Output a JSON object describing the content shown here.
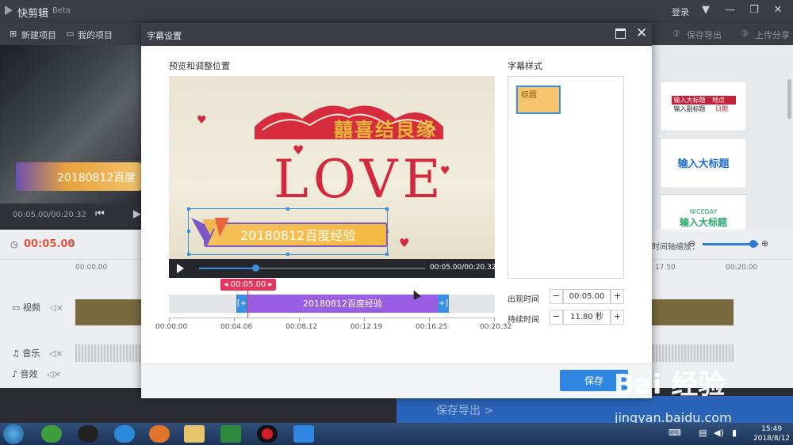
{
  "app": {
    "name": "快剪辑",
    "badge": "Beta",
    "login": "登录"
  },
  "toolbar": {
    "new_project": "新建项目",
    "my_projects": "我的项目",
    "step2": "保存导出",
    "step3": "上传分享"
  },
  "left_preview": {
    "banner_text": "20180812百度",
    "timecode": "00:05.00/00:20.32"
  },
  "timeline": {
    "current_time": "00:05.00",
    "ruler": [
      "00:00.00",
      "17.50",
      "00:20.00"
    ],
    "zoom_label": "时间轴缩放：",
    "tracks": {
      "video": "视频",
      "music": "音乐",
      "sfx": "音效"
    }
  },
  "templates": {
    "t1_title": "输入大标题",
    "t1_sub": "输入副标题",
    "t1_place": "地点",
    "t1_date": "日期",
    "t2_title": "输入大标题",
    "t3_brand": "NICEDAY",
    "t3_title": "输入大标题"
  },
  "dialog": {
    "title": "字幕设置",
    "preview_label": "预览和调整位置",
    "style_label": "字幕样式",
    "preview": {
      "crown_text": "囍喜结良缘",
      "love_text": "LOVE",
      "subtitle_text": "20180812百度经验"
    },
    "player": {
      "time": "00:05.00/00:20.32",
      "progress": 0.25
    },
    "marker_time": "00:05.00",
    "clip_text": "20180812百度经验",
    "axis_ticks": [
      "00:00.00",
      "00:04.06",
      "00:08.12",
      "00:12.19",
      "00:16.25",
      "00:20.32"
    ],
    "style_selected": "标题",
    "appear_label": "出现时间",
    "appear_value": "00:05.00",
    "duration_label": "持续时间",
    "duration_value": "11.80 秒",
    "save": "保存"
  },
  "export_button": "保存导出 >",
  "watermark": {
    "logo": "Bai 经验",
    "url": "jingyan.baidu.com"
  },
  "taskbar": {
    "clock_time": "15:49",
    "clock_date": "2018/8/12"
  },
  "colors": {
    "accent": "#2f86e0",
    "marker": "#e3365c",
    "clip": "#9a5ee2",
    "current_time": "#e0563a"
  }
}
